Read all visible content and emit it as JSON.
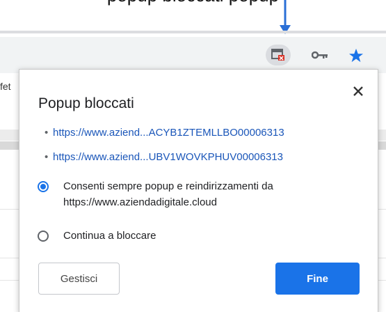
{
  "caption": "popup bloccati popup",
  "toolbar": {
    "icons": [
      "popup-blocked-icon",
      "key-icon",
      "star-icon"
    ],
    "star_color": "#1a73e8",
    "blocked_badge_color": "#d93025"
  },
  "background": {
    "left_fragment": "fet"
  },
  "popup": {
    "title": "Popup bloccati",
    "links": [
      "https://www.aziend...ACYB1ZTEMLLBO00006313",
      "https://www.aziend...UBV1WOVKPHUV00006313"
    ],
    "options": {
      "allow_line1": "Consenti sempre popup e reindirizzamenti da",
      "allow_line2": "https://www.aziendadigitale.cloud",
      "block": "Continua a bloccare"
    },
    "selected_option": "allow",
    "buttons": {
      "manage": "Gestisci",
      "done": "Fine"
    },
    "accent_color": "#1a73e8"
  }
}
